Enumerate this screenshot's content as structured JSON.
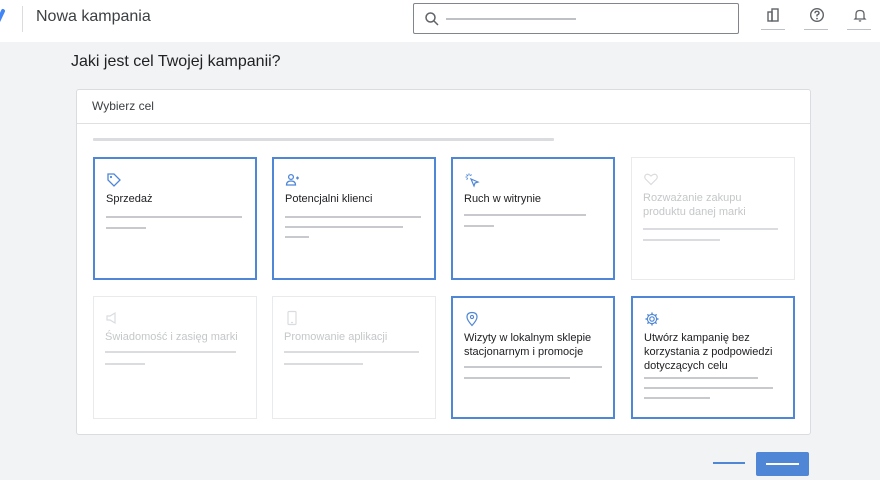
{
  "header": {
    "title": "Nowa kampania",
    "search_icon": "search-icon",
    "actions": [
      {
        "name": "tools-icon"
      },
      {
        "name": "help-icon"
      },
      {
        "name": "notifications-icon"
      }
    ]
  },
  "main": {
    "question": "Jaki jest cel Twojej kampanii?",
    "panel_title": "Wybierz cel"
  },
  "goals": [
    {
      "label": "Sprzedaż",
      "icon": "tag-icon",
      "selected": true,
      "disabled": false
    },
    {
      "label": "Potencjalni klienci",
      "icon": "people-icon",
      "selected": true,
      "disabled": false
    },
    {
      "label": "Ruch w witrynie",
      "icon": "cursor-click-icon",
      "selected": true,
      "disabled": false
    },
    {
      "label": "Rozważanie zakupu produktu danej marki",
      "icon": "heart-icon",
      "selected": false,
      "disabled": true
    },
    {
      "label": "Świadomość i zasięg marki",
      "icon": "megaphone-icon",
      "selected": false,
      "disabled": true
    },
    {
      "label": "Promowanie aplikacji",
      "icon": "phone-icon",
      "selected": false,
      "disabled": true
    },
    {
      "label": "Wizyty w lokalnym sklepie stacjonarnym i promocje",
      "icon": "location-pin-icon",
      "selected": true,
      "disabled": false
    },
    {
      "label": "Utwórz kampanię bez korzystania z podpowiedzi dotyczących celu",
      "icon": "gear-icon",
      "selected": true,
      "disabled": false
    }
  ],
  "colors": {
    "accent": "#4f86d6",
    "background": "#f1f3f4",
    "disabled_text": "#c4c7c9"
  }
}
